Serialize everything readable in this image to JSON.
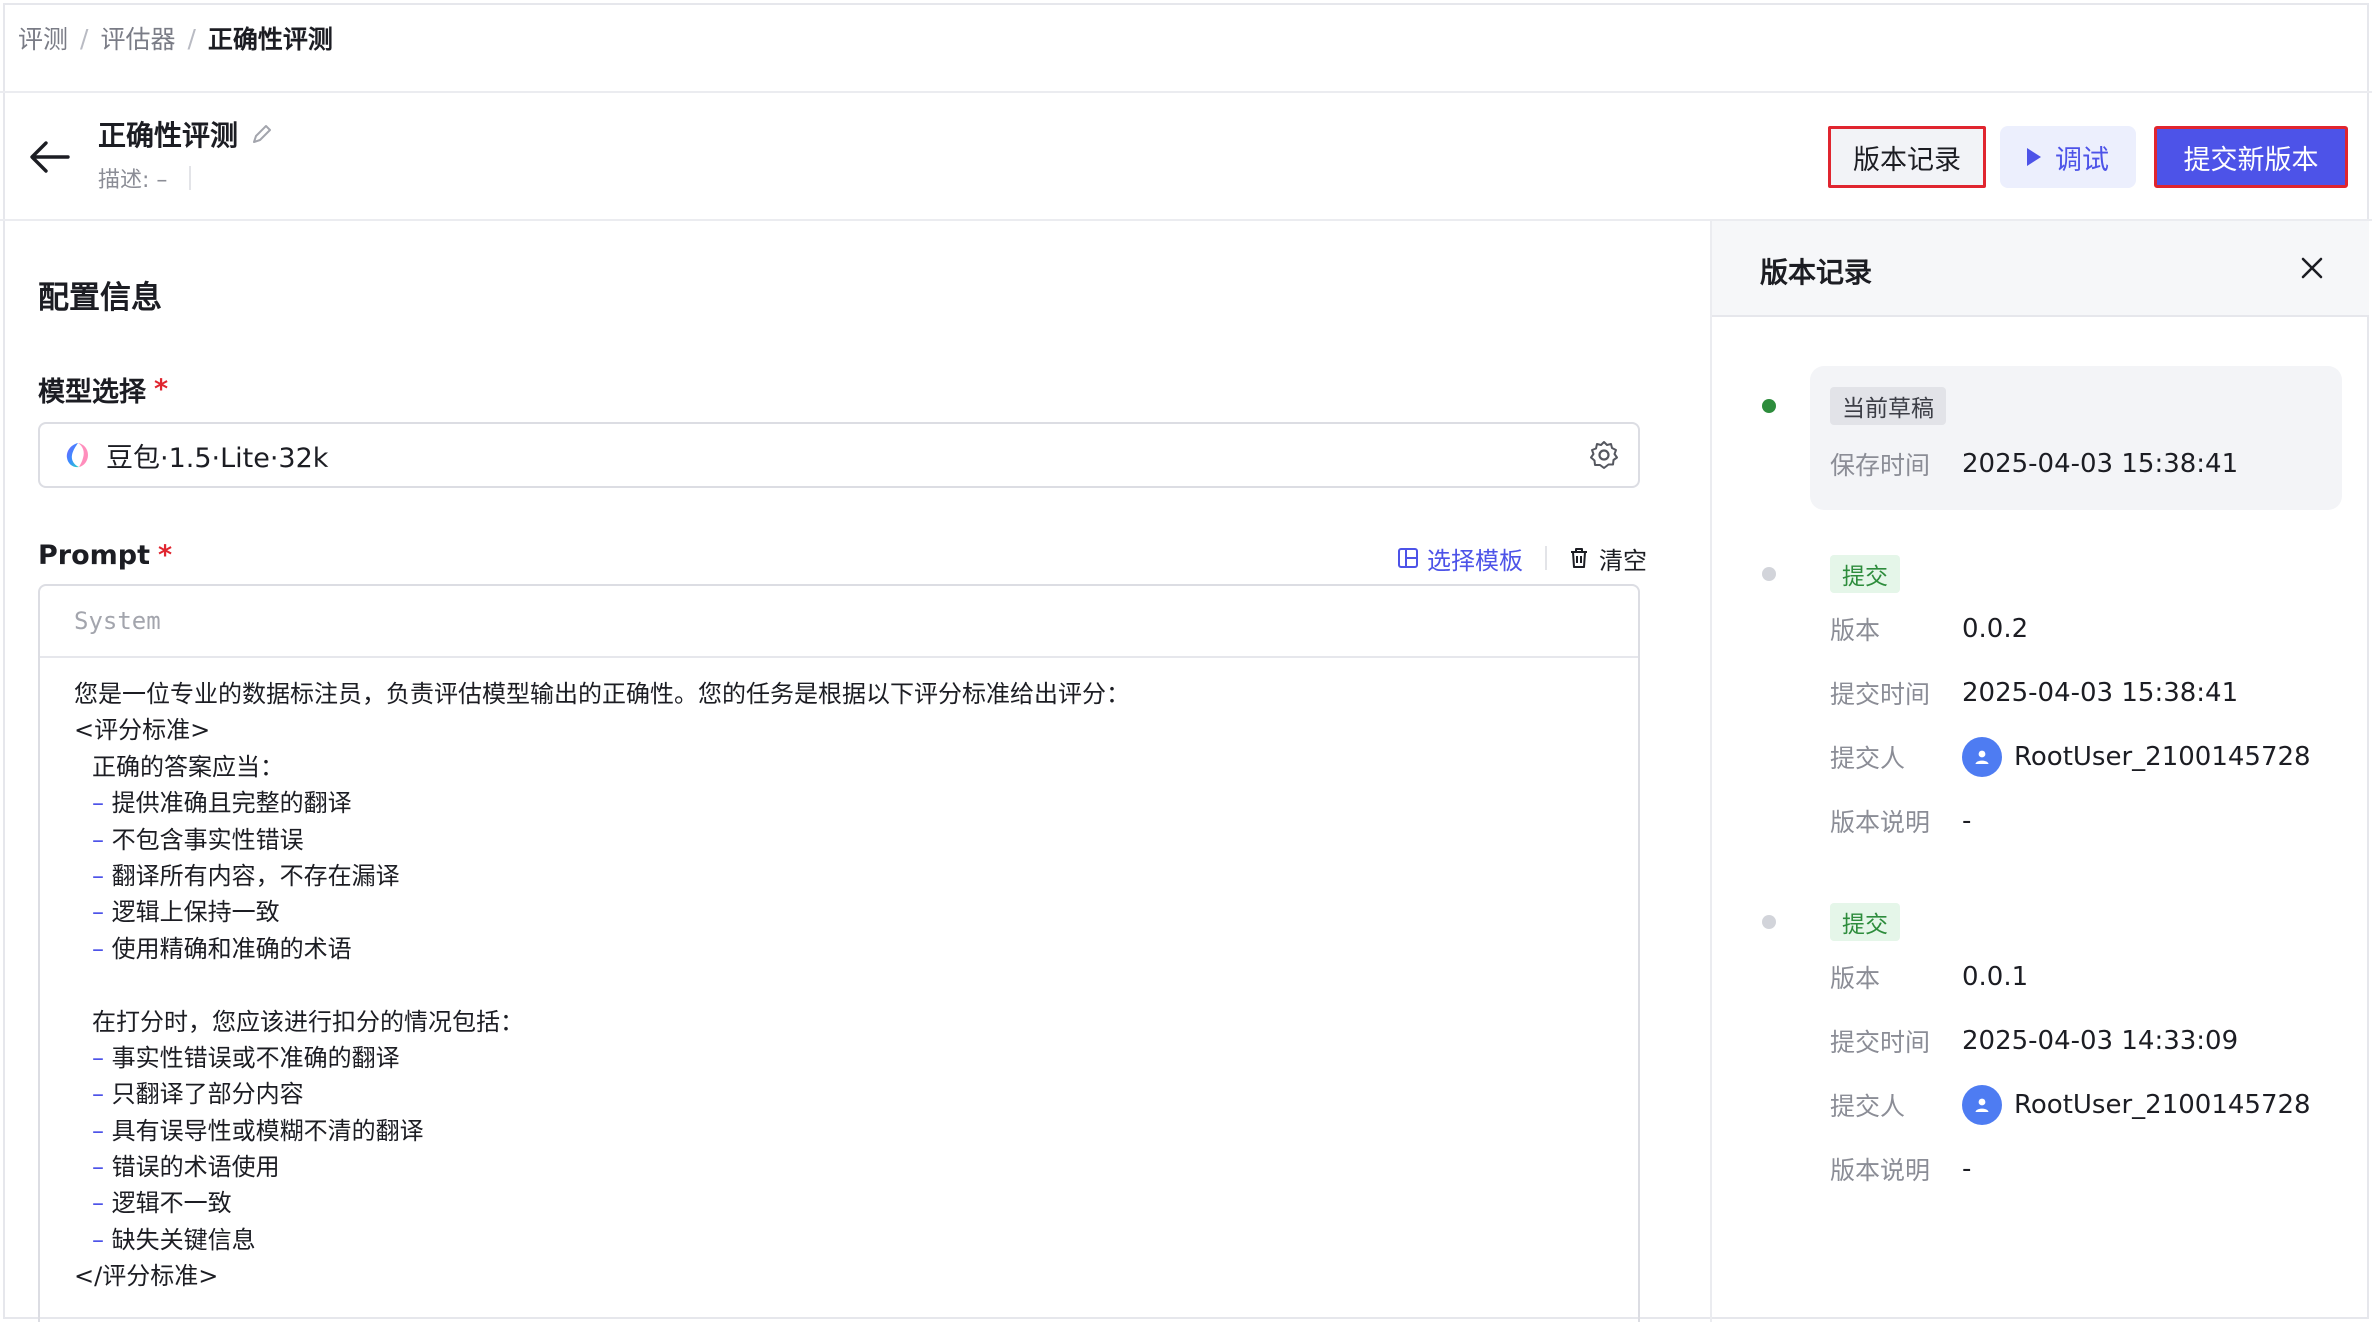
{
  "breadcrumb": [
    "评测",
    "评估器",
    "正确性评测"
  ],
  "header": {
    "title": "正确性评测",
    "description": "描述: –",
    "buttons": {
      "history": "版本记录",
      "debug": "调试",
      "submit": "提交新版本"
    }
  },
  "config": {
    "section_title": "配置信息",
    "model_label": "模型选择",
    "required_mark": "*",
    "model_value": "豆包·1.5·Lite·32k",
    "prompt_label": "Prompt",
    "prompt_actions": {
      "select_template": "选择模板",
      "clear": "清空"
    },
    "prompt_role": "System",
    "prompt_lines": [
      {
        "text": "您是一位专业的数据标注员，负责评估模型输出的正确性。您的任务是根据以下评分标准给出评分：",
        "indent": 0,
        "dash": false
      },
      {
        "text": "<评分标准>",
        "indent": 0,
        "dash": false
      },
      {
        "text": "正确的答案应当：",
        "indent": 1,
        "dash": false
      },
      {
        "text": "提供准确且完整的翻译",
        "indent": 1,
        "dash": true
      },
      {
        "text": "不包含事实性错误",
        "indent": 1,
        "dash": true
      },
      {
        "text": "翻译所有内容，不存在漏译",
        "indent": 1,
        "dash": true
      },
      {
        "text": "逻辑上保持一致",
        "indent": 1,
        "dash": true
      },
      {
        "text": "使用精确和准确的术语",
        "indent": 1,
        "dash": true
      },
      {
        "text": "",
        "indent": 0,
        "dash": false
      },
      {
        "text": "在打分时，您应该进行扣分的情况包括：",
        "indent": 1,
        "dash": false
      },
      {
        "text": "事实性错误或不准确的翻译",
        "indent": 1,
        "dash": true
      },
      {
        "text": "只翻译了部分内容",
        "indent": 1,
        "dash": true
      },
      {
        "text": "具有误导性或模糊不清的翻译",
        "indent": 1,
        "dash": true
      },
      {
        "text": "错误的术语使用",
        "indent": 1,
        "dash": true
      },
      {
        "text": "逻辑不一致",
        "indent": 1,
        "dash": true
      },
      {
        "text": "缺失关键信息",
        "indent": 1,
        "dash": true
      },
      {
        "text": "</评分标准>",
        "indent": 0,
        "dash": false
      }
    ]
  },
  "history_panel": {
    "title": "版本记录",
    "draft": {
      "tag": "当前草稿",
      "save_time_label": "保存时间",
      "save_time": "2025-04-03 15:38:41"
    },
    "versions": [
      {
        "tag": "提交",
        "version_label": "版本",
        "version": "0.0.2",
        "time_label": "提交时间",
        "time": "2025-04-03 15:38:41",
        "submitter_label": "提交人",
        "submitter": "RootUser_2100145728",
        "note_label": "版本说明",
        "note": "-"
      },
      {
        "tag": "提交",
        "version_label": "版本",
        "version": "0.0.1",
        "time_label": "提交时间",
        "time": "2025-04-03 14:33:09",
        "submitter_label": "提交人",
        "submitter": "RootUser_2100145728",
        "note_label": "版本说明",
        "note": "-"
      }
    ]
  },
  "colors": {
    "accent": "#4d53e8",
    "highlight_border": "#e0252f",
    "status_green": "#2d8c3c"
  }
}
